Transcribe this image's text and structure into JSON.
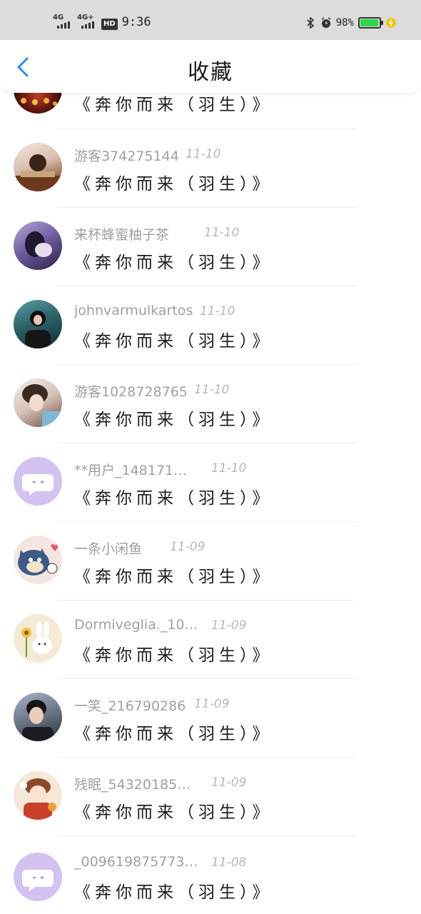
{
  "status_bar": {
    "net1": "4G",
    "net2": "4G+",
    "hd": "HD",
    "time": "9:36",
    "battery_pct": "98%",
    "battery_level": 0.98,
    "battery_color": "#2bd84a"
  },
  "header": {
    "title": "收藏",
    "back_icon": "chevron-left-icon",
    "accent": "#2b8cf0"
  },
  "items": [
    {
      "user": "",
      "date": "",
      "song": "《奔你而来（羽生）》",
      "avatar": "photo-avatar"
    },
    {
      "user": "游客374275144",
      "date": "11-10",
      "song": "《奔你而来（羽生）》",
      "avatar": "photo-avatar"
    },
    {
      "user": "来杯蜂蜜柚子茶",
      "date": "11-10",
      "song": "《奔你而来（羽生）》",
      "avatar": "photo-avatar"
    },
    {
      "user": "johnvarmulkartos",
      "date": "11-10",
      "song": "《奔你而来（羽生）》",
      "avatar": "photo-avatar"
    },
    {
      "user": "游客1028728765",
      "date": "11-10",
      "song": "《奔你而来（羽生）》",
      "avatar": "photo-avatar"
    },
    {
      "user": "**用户_148171…",
      "date": "11-10",
      "song": "《奔你而来（羽生）》",
      "avatar": "default-chat-avatar"
    },
    {
      "user": "一条小闲鱼",
      "date": "11-09",
      "song": "《奔你而来（羽生）》",
      "avatar": "cartoon-cat-avatar"
    },
    {
      "user": "Dormiveglia._10…",
      "date": "11-09",
      "song": "《奔你而来（羽生）》",
      "avatar": "cartoon-bunny-avatar"
    },
    {
      "user": "一笑_216790286",
      "date": "11-09",
      "song": "《奔你而来（羽生）》",
      "avatar": "photo-avatar"
    },
    {
      "user": "残眠_54320185…",
      "date": "11-09",
      "song": "《奔你而来（羽生）》",
      "avatar": "cartoon-girl-avatar"
    },
    {
      "user": "_009619875773…",
      "date": "11-08",
      "song": "《奔你而来（羽生）》",
      "avatar": "default-chat-avatar"
    }
  ]
}
